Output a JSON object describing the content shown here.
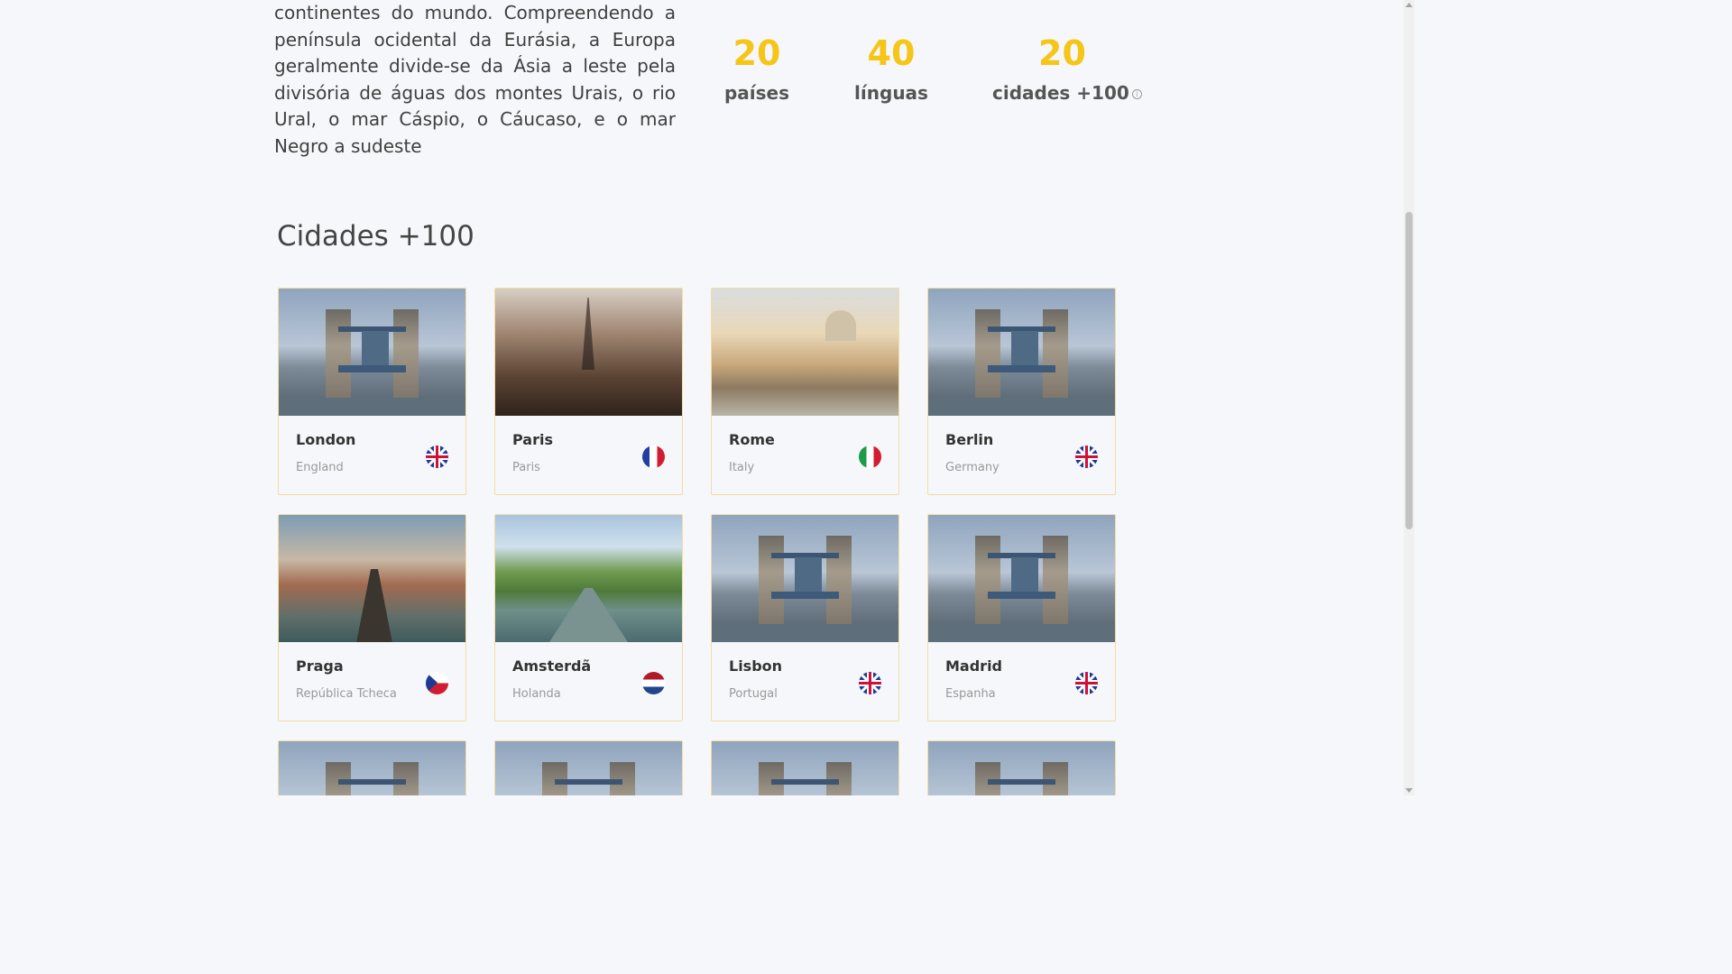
{
  "intro": {
    "text": "continentes do mundo. Compreendendo a península ocidental da Eurásia, a Europa geralmente divide-se da Ásia a leste pela divisória de águas dos montes Urais, o rio Ural, o mar Cáspio, o Cáucaso, e o mar Negro a sudeste"
  },
  "stats": [
    {
      "value": "20",
      "label": "países"
    },
    {
      "value": "40",
      "label": "línguas"
    },
    {
      "value": "20",
      "label": "cidades +100",
      "info_icon": "info-icon"
    }
  ],
  "section": {
    "title": "Cidades +100"
  },
  "cities": [
    {
      "name": "London",
      "country": "England",
      "flag": "uk",
      "image": "bridge"
    },
    {
      "name": "Paris",
      "country": "Paris",
      "flag": "fr",
      "image": "paris"
    },
    {
      "name": "Rome",
      "country": "Italy",
      "flag": "it",
      "image": "rome"
    },
    {
      "name": "Berlin",
      "country": "Germany",
      "flag": "uk",
      "image": "bridge"
    },
    {
      "name": "Praga",
      "country": "República Tcheca",
      "flag": "cz",
      "image": "prague"
    },
    {
      "name": "Amsterdã",
      "country": "Holanda",
      "flag": "nl",
      "image": "amsterdam"
    },
    {
      "name": "Lisbon",
      "country": "Portugal",
      "flag": "uk",
      "image": "bridge"
    },
    {
      "name": "Madrid",
      "country": "Espanha",
      "flag": "uk",
      "image": "bridge"
    }
  ],
  "colors": {
    "accent": "#f5c518",
    "card_border": "#f2dca0",
    "background": "#f5f7fa"
  }
}
